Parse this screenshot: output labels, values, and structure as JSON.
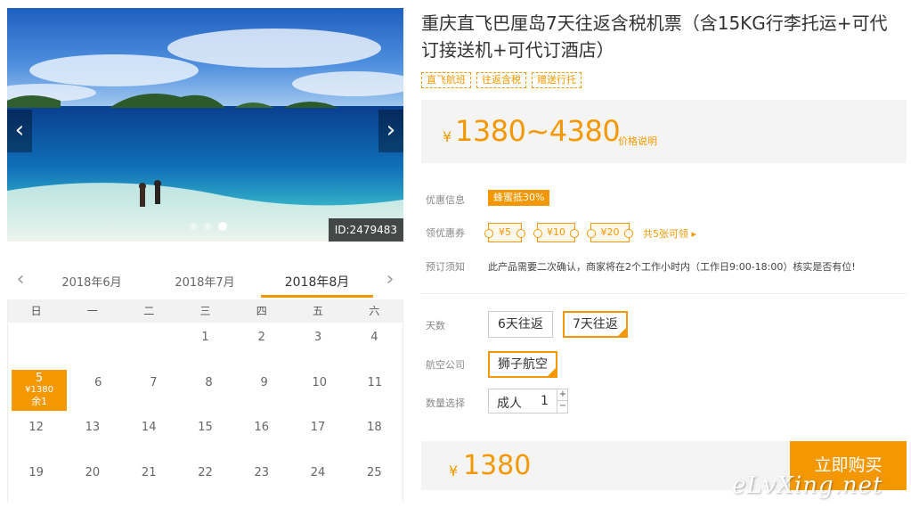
{
  "gallery": {
    "image_id": "ID:2479483",
    "prev_symbol": "‹",
    "next_symbol": "›"
  },
  "calendar": {
    "prev_symbol": "‹",
    "next_symbol": "›",
    "months": [
      {
        "label": "2018年6月"
      },
      {
        "label": "2018年7月"
      },
      {
        "label": "2018年8月"
      }
    ],
    "weekdays": [
      "日",
      "一",
      "二",
      "三",
      "四",
      "五",
      "六"
    ],
    "rows": [
      [
        "",
        "",
        "",
        "1",
        "2",
        "3",
        "4"
      ],
      [
        "5",
        "6",
        "7",
        "8",
        "9",
        "10",
        "11"
      ],
      [
        "12",
        "13",
        "14",
        "15",
        "16",
        "17",
        "18"
      ],
      [
        "19",
        "20",
        "21",
        "22",
        "23",
        "24",
        "25"
      ]
    ],
    "selected": {
      "day": "5",
      "price": "¥1380",
      "remain": "余1"
    }
  },
  "product": {
    "title": "重庆直飞巴厘岛7天往返含税机票（含15KG行李托运+可代订接送机+可代订酒店）",
    "tags": [
      "直飞航班",
      "往返含税",
      "赠送行托"
    ],
    "price": {
      "currency": "¥",
      "range": "1380~4380",
      "note": "价格说明"
    }
  },
  "offers": {
    "promo_label": "优惠信息",
    "promo_badge": "蜂蜜抵30%",
    "coupon_label": "领优惠券",
    "coupons": [
      "¥5",
      "¥10",
      "¥20"
    ],
    "coupon_more": "共5张可领 ▸",
    "booking_label": "预订须知",
    "booking_note": "此产品需要二次确认，商家将在2个工作小时内（工作日9:00-18:00）核实是否有位!"
  },
  "options": {
    "days_label": "天数",
    "days": [
      "6天往返",
      "7天往返"
    ],
    "airline_label": "航空公司",
    "airline": "狮子航空",
    "qty_label": "数量选择",
    "qty_unit": "成人",
    "qty_value": "1",
    "plus": "+",
    "minus": "−"
  },
  "checkout": {
    "currency": "¥",
    "total": "1380",
    "buy_label": "立即购买"
  },
  "watermark": "eLvXing.net",
  "colors": {
    "accent": "#f39800"
  }
}
